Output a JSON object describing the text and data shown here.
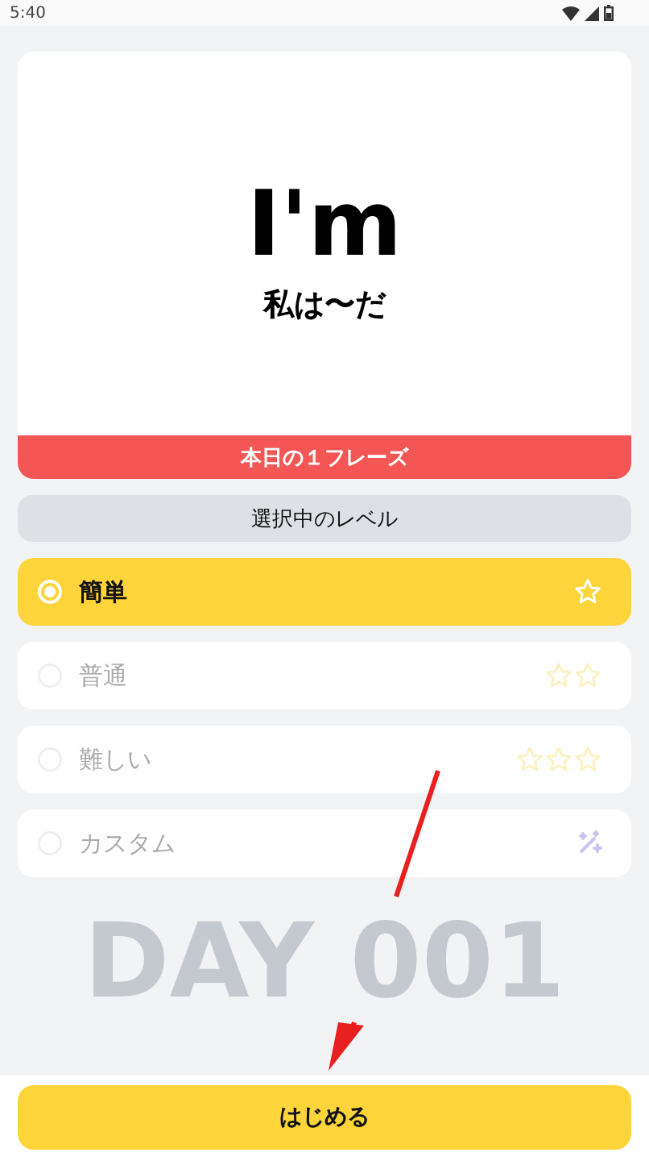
{
  "status_bar": {
    "time": "5:40"
  },
  "phrase_card": {
    "phrase": "I'm",
    "translation": "私は〜だ",
    "banner": "本日の１フレーズ"
  },
  "level_header": "選択中のレベル",
  "levels": [
    {
      "label": "簡単",
      "kind": "one_star",
      "selected": true
    },
    {
      "label": "普通",
      "kind": "two_stars",
      "selected": false
    },
    {
      "label": "難しい",
      "kind": "three_stars",
      "selected": false
    },
    {
      "label": "カスタム",
      "kind": "wand",
      "selected": false
    }
  ],
  "day_label": "DAY 001",
  "start_button": "はじめる"
}
